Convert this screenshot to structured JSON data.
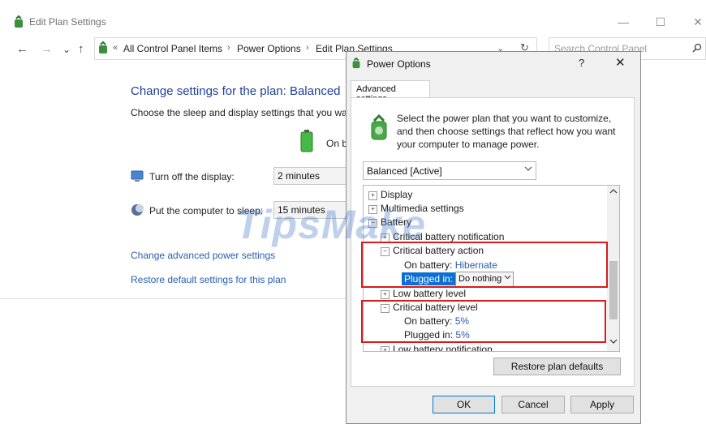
{
  "window": {
    "title": "Edit Plan Settings",
    "min": "—",
    "max": "☐",
    "close": "✕"
  },
  "nav": {
    "back": "←",
    "forward": "→",
    "recent": "⌄",
    "up": "↑",
    "overflow": "«",
    "breadcrumb": [
      "All Control Panel Items",
      "Power Options",
      "Edit Plan Settings"
    ],
    "sep": "›",
    "dropdown": "⌄",
    "refresh": "↻",
    "search_placeholder": "Search Control Panel"
  },
  "main": {
    "title": "Change settings for the plan: Balanced",
    "subtitle": "Choose the sleep and display settings that you want your computer to use.",
    "on_battery_header": "On battery",
    "display_label": "Turn off the display:",
    "display_value": "2 minutes",
    "sleep_label": "Put the computer to sleep:",
    "sleep_value": "15 minutes",
    "advanced_link": "Change advanced power settings",
    "restore_link": "Restore default settings for this plan"
  },
  "dialog": {
    "title": "Power Options",
    "help": "?",
    "close": "✕",
    "tab": "Advanced settings",
    "intro": "Select the power plan that you want to customize, and then choose settings that reflect how you want your computer to manage power.",
    "plan_selected": "Balanced [Active]",
    "tree": {
      "display": "Display",
      "multimedia": "Multimedia settings",
      "battery": "Battery",
      "critical_notification": "Critical battery notification",
      "critical_action": "Critical battery action",
      "on_battery_label": "On battery:",
      "on_battery_value": "Hibernate",
      "plugged_in_label": "Plugged in:",
      "plugged_in_value": "Do nothing",
      "low_level": "Low battery level",
      "critical_level": "Critical battery level",
      "level_on_battery_label": "On battery:",
      "level_on_battery_value": "5%",
      "level_plugged_label": "Plugged in:",
      "level_plugged_value": "5%",
      "low_notification": "Low battery notification"
    },
    "restore_button": "Restore plan defaults",
    "ok": "OK",
    "cancel": "Cancel",
    "apply": "Apply"
  },
  "watermark": "TipsMake",
  "colors": {
    "link": "#2a5db0",
    "title_blue": "#1e3f99",
    "highlight": "#d81b1b",
    "selection": "#0e6fd3"
  },
  "icons": {
    "window": "power-options-icon",
    "battery": "battery-icon",
    "display": "monitor-icon",
    "sleep": "moon-icon",
    "search": "search-icon"
  }
}
